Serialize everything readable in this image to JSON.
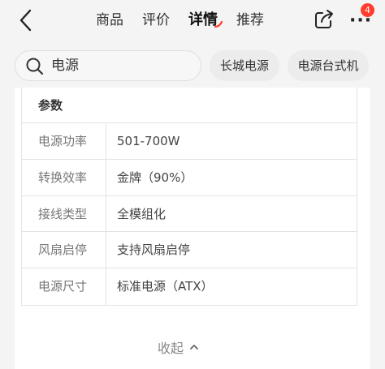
{
  "nav": {
    "back_icon": "chevron-left-icon",
    "tabs": [
      {
        "label": "商品"
      },
      {
        "label": "评价"
      },
      {
        "label": "详情"
      },
      {
        "label": "推荐"
      }
    ],
    "active_tab": "详情",
    "share_icon": "share-icon",
    "more_icon": "more-dots-icon",
    "badge_count": "4",
    "accent_color": "#ff3c2e"
  },
  "search": {
    "icon": "search-icon",
    "query": "电源",
    "chips": [
      {
        "label": "长城电源"
      },
      {
        "label": "电源台式机"
      }
    ]
  },
  "params": {
    "header": "参数",
    "rows": [
      {
        "key": "电源功率",
        "value": "501-700W"
      },
      {
        "key": "转换效率",
        "value": "金牌（90%）"
      },
      {
        "key": "接线类型",
        "value": "全模组化"
      },
      {
        "key": "风扇启停",
        "value": "支持风扇启停"
      },
      {
        "key": "电源尺寸",
        "value": "标准电源（ATX）"
      }
    ]
  },
  "collapse": {
    "label": "收起",
    "icon": "chevron-up-icon"
  }
}
